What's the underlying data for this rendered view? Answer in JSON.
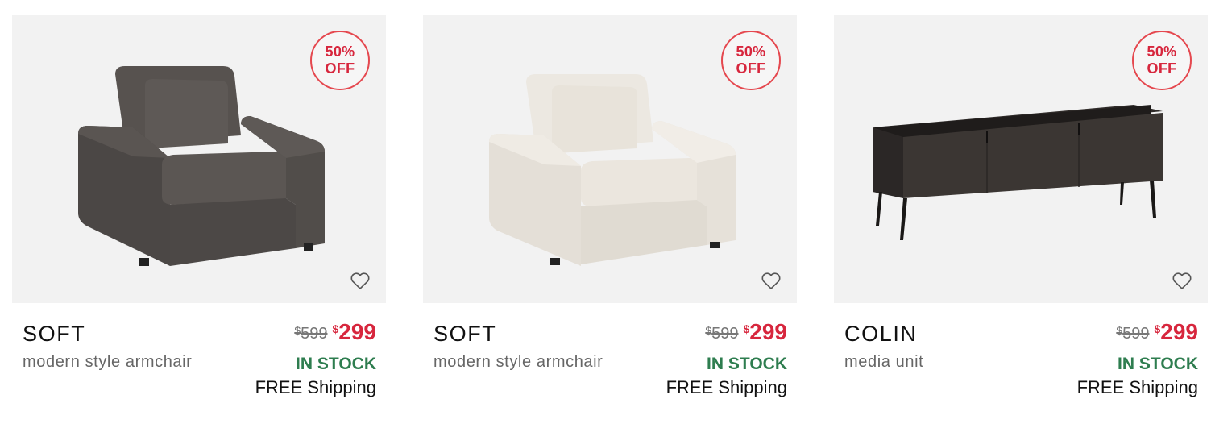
{
  "products": [
    {
      "badge": {
        "pct": "50%",
        "text": "OFF"
      },
      "name": "SOFT",
      "subtitle": "modern style armchair",
      "old_price": {
        "currency": "$",
        "amount": "599"
      },
      "price": {
        "currency": "$",
        "amount": "299"
      },
      "stock": "IN STOCK",
      "shipping": "FREE Shipping",
      "image": "dark-grey-armchair",
      "color": "#4a4644"
    },
    {
      "badge": {
        "pct": "50%",
        "text": "OFF"
      },
      "name": "SOFT",
      "subtitle": "modern style armchair",
      "old_price": {
        "currency": "$",
        "amount": "599"
      },
      "price": {
        "currency": "$",
        "amount": "299"
      },
      "stock": "IN STOCK",
      "shipping": "FREE Shipping",
      "image": "cream-armchair",
      "color": "#e6e2da"
    },
    {
      "badge": {
        "pct": "50%",
        "text": "OFF"
      },
      "name": "COLIN",
      "subtitle": "media unit",
      "old_price": {
        "currency": "$",
        "amount": "599"
      },
      "price": {
        "currency": "$",
        "amount": "299"
      },
      "stock": "IN STOCK",
      "shipping": "FREE Shipping",
      "image": "dark-media-unit",
      "color": "#3a3532"
    }
  ],
  "colors": {
    "sale_red": "#d7263d",
    "stock_green": "#2e7d4f",
    "image_bg": "#f2f2f2"
  },
  "icons": {
    "wishlist": "heart-outline-icon"
  }
}
